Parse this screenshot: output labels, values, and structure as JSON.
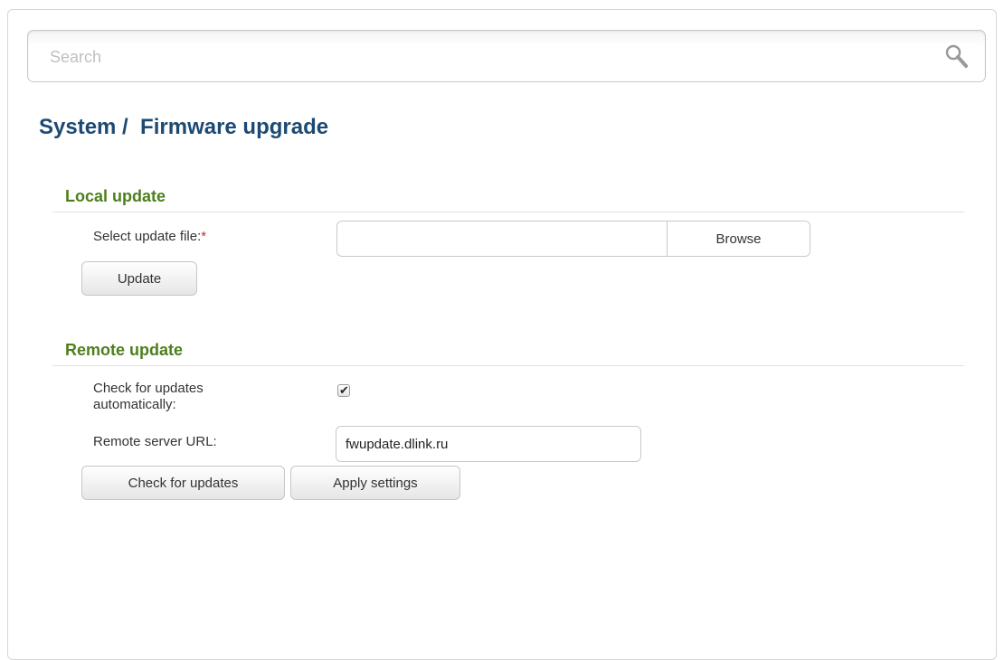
{
  "search": {
    "placeholder": "Search",
    "icon": "search-icon"
  },
  "page": {
    "title": "System /  Firmware upgrade"
  },
  "local_update": {
    "title": "Local update",
    "file_label": "Select update file:",
    "required_mark": "*",
    "file_value": "",
    "browse_label": "Browse",
    "update_label": "Update"
  },
  "remote_update": {
    "title": "Remote update",
    "auto_check_label_line1": "Check for updates",
    "auto_check_label_line2": "automatically:",
    "auto_check_checked": true,
    "checkmark": "✔",
    "url_label": "Remote server URL:",
    "url_value": "fwupdate.dlink.ru",
    "check_updates_label": "Check for updates",
    "apply_label": "Apply settings"
  },
  "colors": {
    "title": "#1d4a73",
    "section_title": "#4d7f1c",
    "required": "#d4262d"
  }
}
